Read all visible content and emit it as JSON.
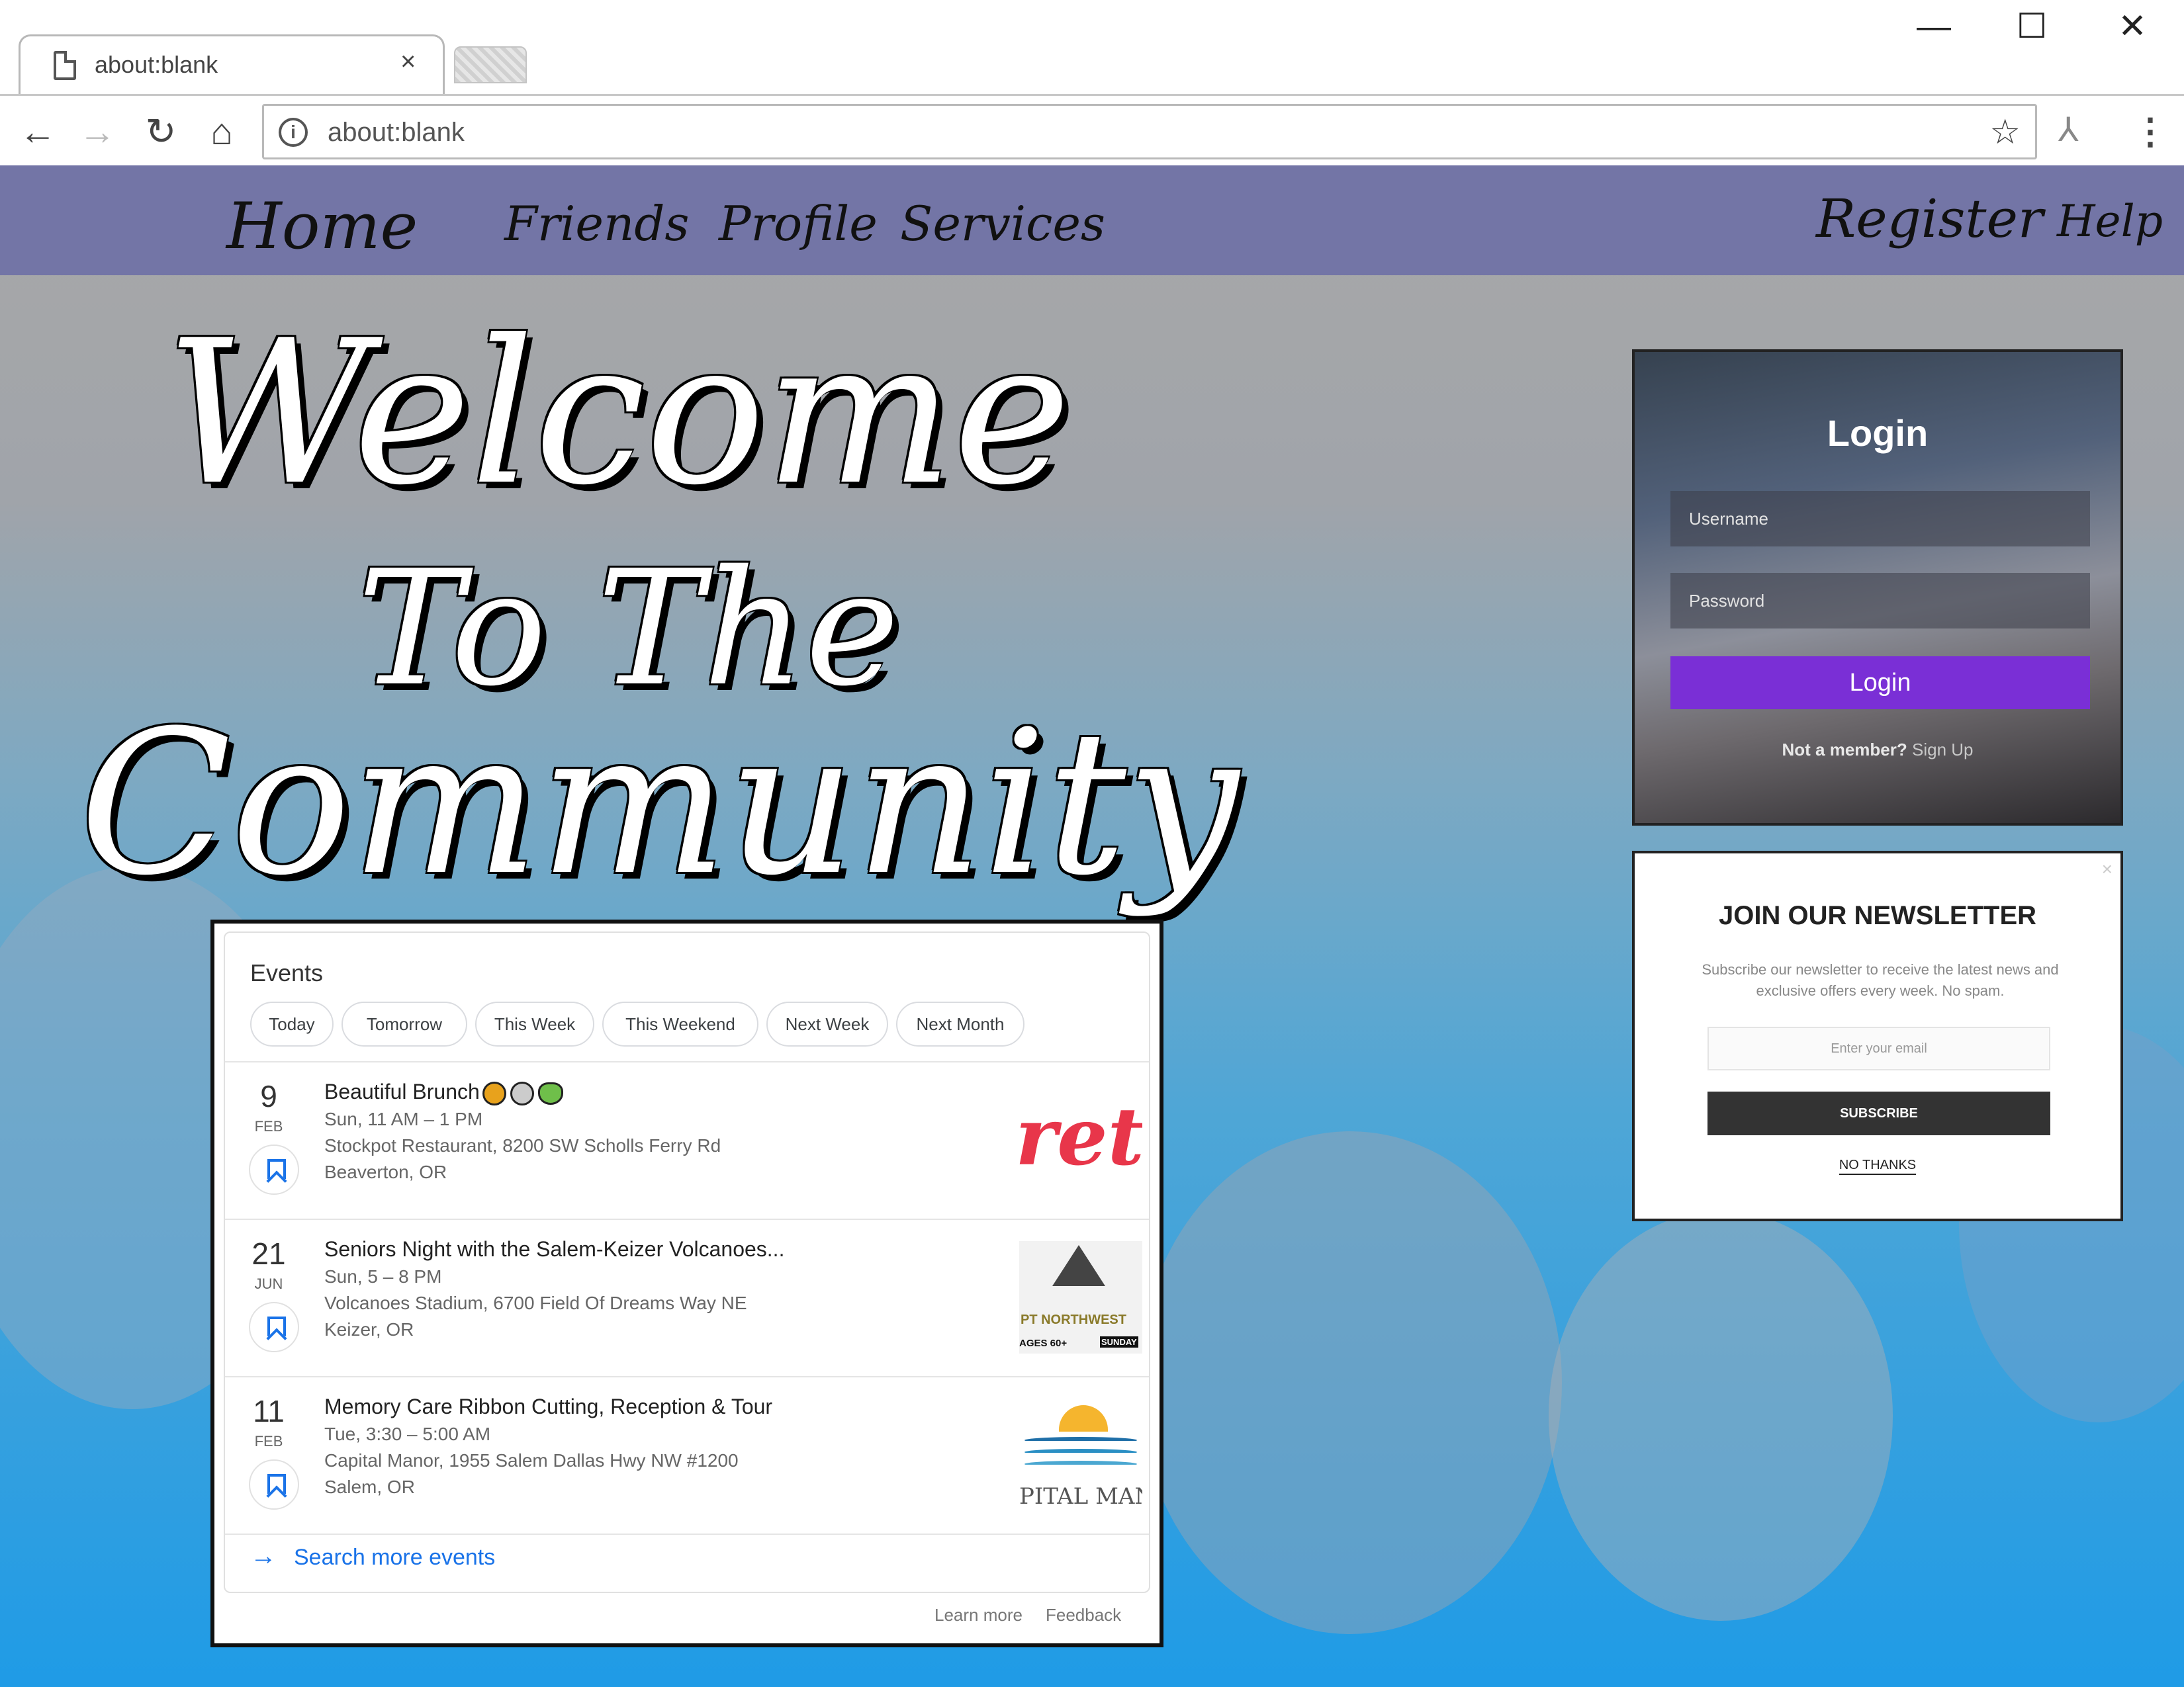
{
  "browser": {
    "tab_title": "about:blank",
    "tab_close": "×",
    "url": "about:blank",
    "window_controls": {
      "minimize": "—",
      "maximize": "☐",
      "close": "✕"
    },
    "nav_icons": {
      "back": "←",
      "forward": "→",
      "reload": "↻",
      "home": "⌂",
      "star": "☆",
      "extension": "⅄",
      "menu": "⋮",
      "info": "i"
    }
  },
  "navbar": {
    "home": "Home",
    "friends": "Friends",
    "profile": "Profile",
    "services": "Services",
    "register": "Register",
    "help": "Help",
    "color": "#7375a6"
  },
  "hero": {
    "line1": "Welcome",
    "line2": "To The",
    "line3": "Community"
  },
  "login": {
    "title": "Login",
    "username_placeholder": "Username",
    "password_placeholder": "Password",
    "button": "Login",
    "not_member": "Not a member?",
    "sign_up": "Sign Up",
    "button_color": "#7a2fd6"
  },
  "newsletter": {
    "close": "×",
    "title": "JOIN OUR NEWSLETTER",
    "text": "Subscribe our newsletter to receive the latest news and exclusive offers every week. No spam.",
    "email_placeholder": "Enter your email",
    "subscribe": "SUBSCRIBE",
    "no_thanks": "NO THANKS"
  },
  "events": {
    "title": "Events",
    "filters": [
      "Today",
      "Tomorrow",
      "This Week",
      "This Weekend",
      "Next Week",
      "Next Month"
    ],
    "items": [
      {
        "day": "9",
        "month": "FEB",
        "title": "Beautiful Brunch",
        "time": "Sun, 11 AM – 1 PM",
        "place": "Stockpot Restaurant, 8200 SW Scholls Ferry Rd",
        "city": "Beaverton, OR",
        "thumb_text": "ret"
      },
      {
        "day": "21",
        "month": "JUN",
        "title": "Seniors Night with the Salem-Keizer Volcanoes...",
        "time": "Sun, 5 – 8 PM",
        "place": "Volcanoes Stadium, 6700 Field Of Dreams Way NE",
        "city": "Keizer, OR",
        "thumb_text": "PT NORTHWEST",
        "thumb_sub": "AGES 60+",
        "thumb_sub2": "SUNDAY"
      },
      {
        "day": "11",
        "month": "FEB",
        "title": "Memory Care Ribbon Cutting, Reception & Tour",
        "time": "Tue, 3:30 – 5:00 AM",
        "place": "Capital Manor, 1955 Salem Dallas Hwy NW #1200",
        "city": "Salem, OR",
        "thumb_text": "PITAL MAN"
      }
    ],
    "search_more": "Search more events",
    "learn_more": "Learn more",
    "feedback": "Feedback",
    "link_color": "#1a73e8"
  }
}
